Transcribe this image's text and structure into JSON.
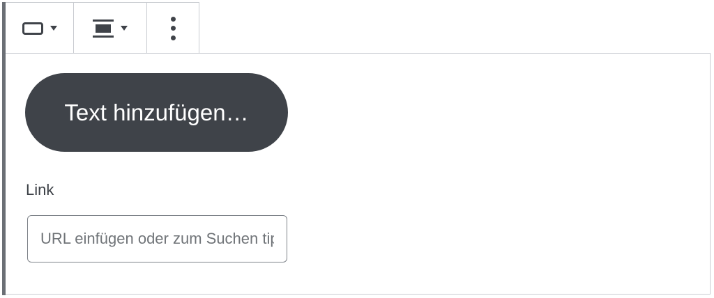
{
  "toolbar": {
    "style_icon": "button-style-icon",
    "align_icon": "align-center-icon",
    "more_icon": "more-vertical-icon"
  },
  "block": {
    "button_text": "Text hinzufügen…",
    "link_label": "Link",
    "url_placeholder": "URL einfügen oder zum Suchen tippen"
  },
  "colors": {
    "button_bg": "#3f4349",
    "button_text": "#ffffff",
    "border": "#c9ccd1",
    "left_bar": "#6b6f75"
  }
}
